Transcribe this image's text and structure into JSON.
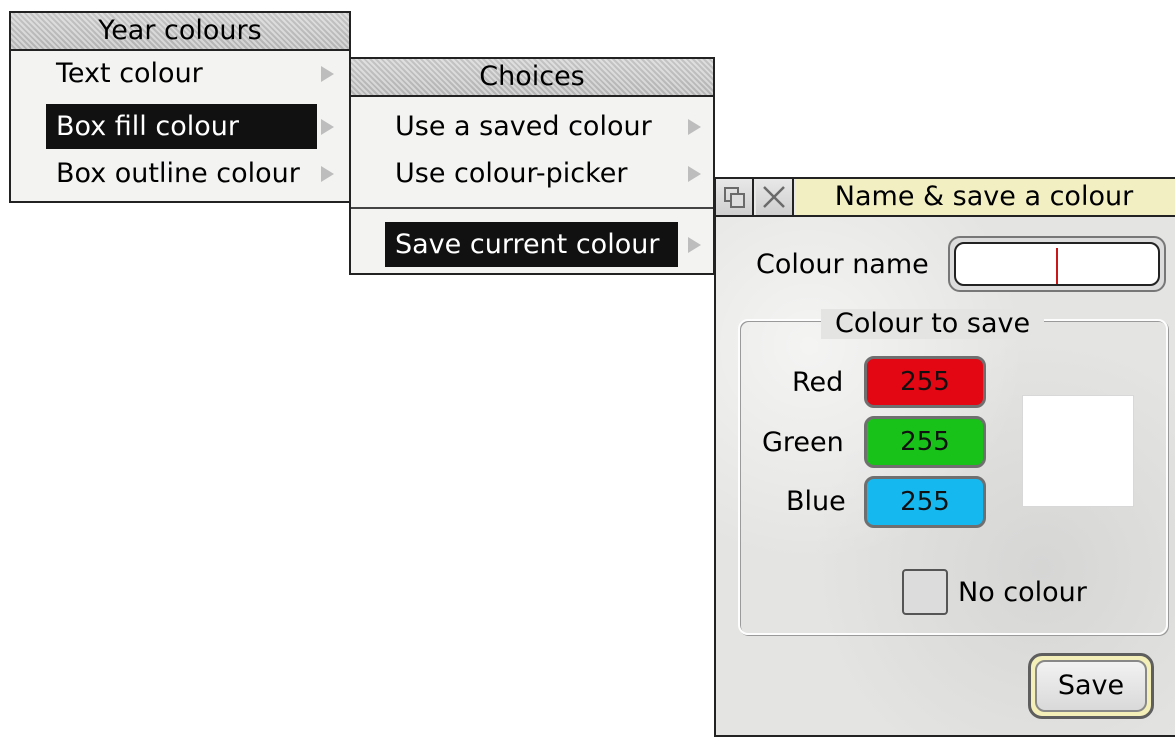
{
  "menus": {
    "year_colours": {
      "title": "Year colours",
      "items": [
        {
          "label": "Text colour"
        },
        {
          "label": "Box fill colour",
          "selected": true
        },
        {
          "label": "Box outline colour"
        }
      ]
    },
    "choices": {
      "title": "Choices",
      "items": [
        {
          "label": "Use a saved colour"
        },
        {
          "label": "Use colour-picker"
        },
        {
          "label": "Save current colour",
          "selected": true
        }
      ]
    }
  },
  "dialog": {
    "title": "Name & save a colour",
    "colour_name_label": "Colour name",
    "colour_name_value": "",
    "group_title": "Colour to save",
    "red_label": "Red",
    "red_value": "255",
    "green_label": "Green",
    "green_value": "255",
    "blue_label": "Blue",
    "blue_value": "255",
    "preview_colour": "#ffffff",
    "no_colour_label": "No colour",
    "no_colour_checked": false,
    "save_label": "Save"
  },
  "colors": {
    "red_field": "#e30613",
    "green_field": "#18c218",
    "blue_field": "#16b8f0",
    "title_bar": "#f2efc2",
    "highlight": "#111111"
  },
  "icons": {
    "back": "back-icon",
    "close": "close-icon",
    "submenu": "submenu-arrow-icon"
  }
}
